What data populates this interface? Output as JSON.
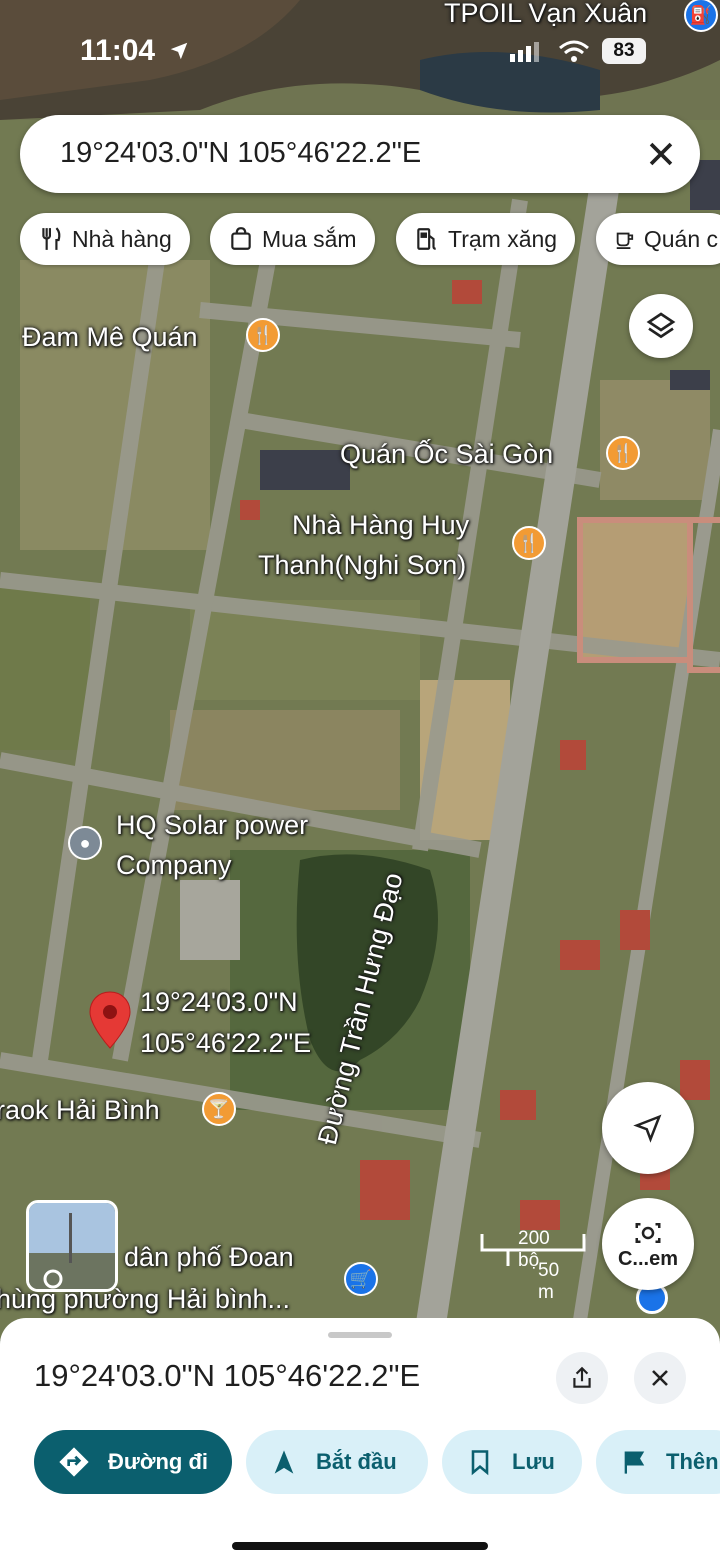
{
  "status_bar": {
    "time": "11:04",
    "battery": "83"
  },
  "search": {
    "query": "19°24'03.0\"N 105°46'22.2\"E"
  },
  "chips": [
    {
      "label": "Nhà hàng",
      "icon": "fork-knife-icon"
    },
    {
      "label": "Mua sắm",
      "icon": "shopping-bag-icon"
    },
    {
      "label": "Trạm xăng",
      "icon": "gas-pump-icon"
    },
    {
      "label": "Quán c",
      "icon": "coffee-cup-icon"
    }
  ],
  "map": {
    "labels": {
      "tpoil": "TPOIL Vạn Xuân",
      "dam_me": "Đam Mê Quán",
      "quan_oc": "Quán Ốc Sài Gòn",
      "nha_hang_line1": "Nhà Hàng Huy",
      "nha_hang_line2": "Thanh(Nghi Sơn)",
      "hq_line1": "HQ Solar power",
      "hq_line2": "Company",
      "coord_line1": "19°24'03.0\"N",
      "coord_line2": "105°46'22.2\"E",
      "karaoke": "raok Hải Bình",
      "dan_pho_line1": "dân phố Đoan",
      "dan_pho_line2": "hùng phường Hải bình...",
      "street": "Đường Trần Hưng Đạo"
    },
    "scale": {
      "top": "200 bộ",
      "bottom": "50 m"
    },
    "camera_label": "C...em",
    "pin_color": "#e53935"
  },
  "sheet": {
    "title": "19°24'03.0\"N 105°46'22.2\"E",
    "actions": [
      {
        "label": "Đường đi",
        "icon": "directions-icon"
      },
      {
        "label": "Bắt đầu",
        "icon": "navigation-arrow-icon"
      },
      {
        "label": "Lưu",
        "icon": "bookmark-icon"
      },
      {
        "label": "Thên",
        "icon": "flag-icon"
      }
    ]
  }
}
